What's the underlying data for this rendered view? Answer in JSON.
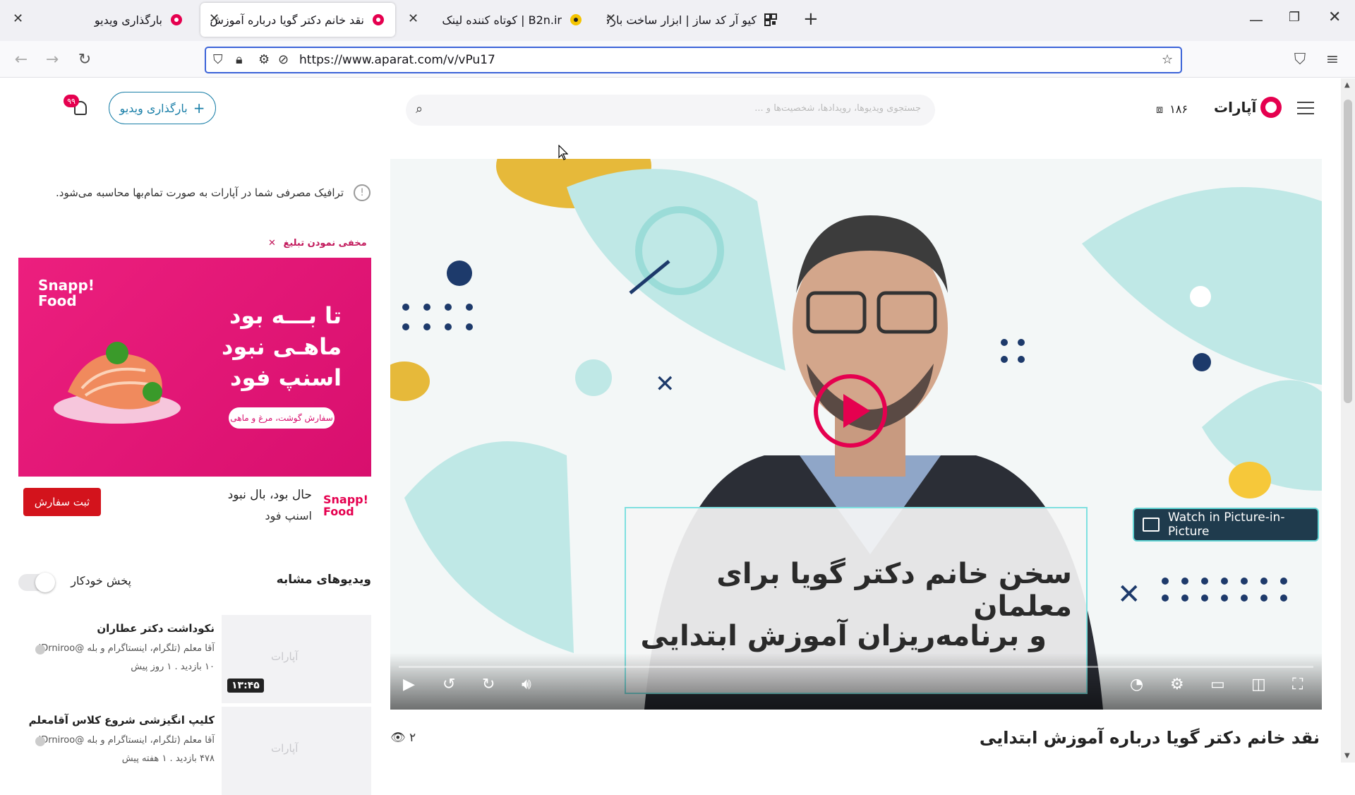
{
  "tabs": [
    {
      "title": "بارگذاری ویدیو",
      "favicon": "aparat-icon"
    },
    {
      "title": "نقد خانم دکتر گویا درباره آموزش",
      "favicon": "aparat-icon"
    },
    {
      "title": "B2n.ir | کوتاه کننده لینک",
      "favicon": "b2n-icon"
    },
    {
      "title": "کیو آر کد ساز | ابزار ساخت بارکد",
      "favicon": "qr-icon"
    }
  ],
  "address_bar": {
    "url": "https://www.aparat.com/v/vPu17"
  },
  "header": {
    "logo_text": "آپارات",
    "balance": "۱۸۶",
    "search_placeholder": "جستجوی ویدیوها، رویدادها، شخصیت‌ها و ...",
    "upload_label": "بارگذاری ویدیو",
    "notification_count": "۹۹"
  },
  "sidebar": {
    "notice": "ترافیک مصرفی شما در آپارات به صورت تمام‌بها محاسبه می‌شود.",
    "hide_ad": "مخفی نمودن تبلیغ",
    "ad": {
      "brand": "Snapp! Food",
      "headline_1": "تا بـــه بود",
      "headline_2": "ماهـی نبود",
      "headline_3": "اسنپ فود",
      "pill": "سفارش گوشت، مرغ و ماهی",
      "title": "حال بود، بال نبود",
      "subtitle": "اسنپ فود",
      "order_button": "ثبت سفارش"
    },
    "similar_title": "ویدیوهای مشابه",
    "autoplay_label": "پخش خودکار",
    "videos": [
      {
        "title": "نکوداشت دکتر عطاران",
        "channel": "آقا معلم (تلگرام، اینستاگرام و بله @Drniroo)",
        "stats": "۱۰ بازدید . ۱ روز پیش",
        "duration": "۱۳:۴۵"
      },
      {
        "title": "کلیپ انگیزشی شروع کلاس آقامعلم",
        "channel": "آقا معلم (تلگرام، اینستاگرام و بله @Drniroo)",
        "stats": "۴۷۸ بازدید . ۱ هفته پیش",
        "duration": ""
      }
    ],
    "thumb_watermark": "آپارات"
  },
  "player": {
    "caption_line_1": "سخن خانم دکتر گویا برای معلمان",
    "caption_line_2": "و برنامه‌ریزان آموزش ابتدایی",
    "pip_label": "Watch in Picture-in-Picture"
  },
  "video": {
    "title": "نقد خانم دکتر گویا درباره آموزش ابتدایی",
    "views": "۲"
  },
  "colors": {
    "brand": "#e5004f",
    "accent": "#1a7fa8"
  }
}
